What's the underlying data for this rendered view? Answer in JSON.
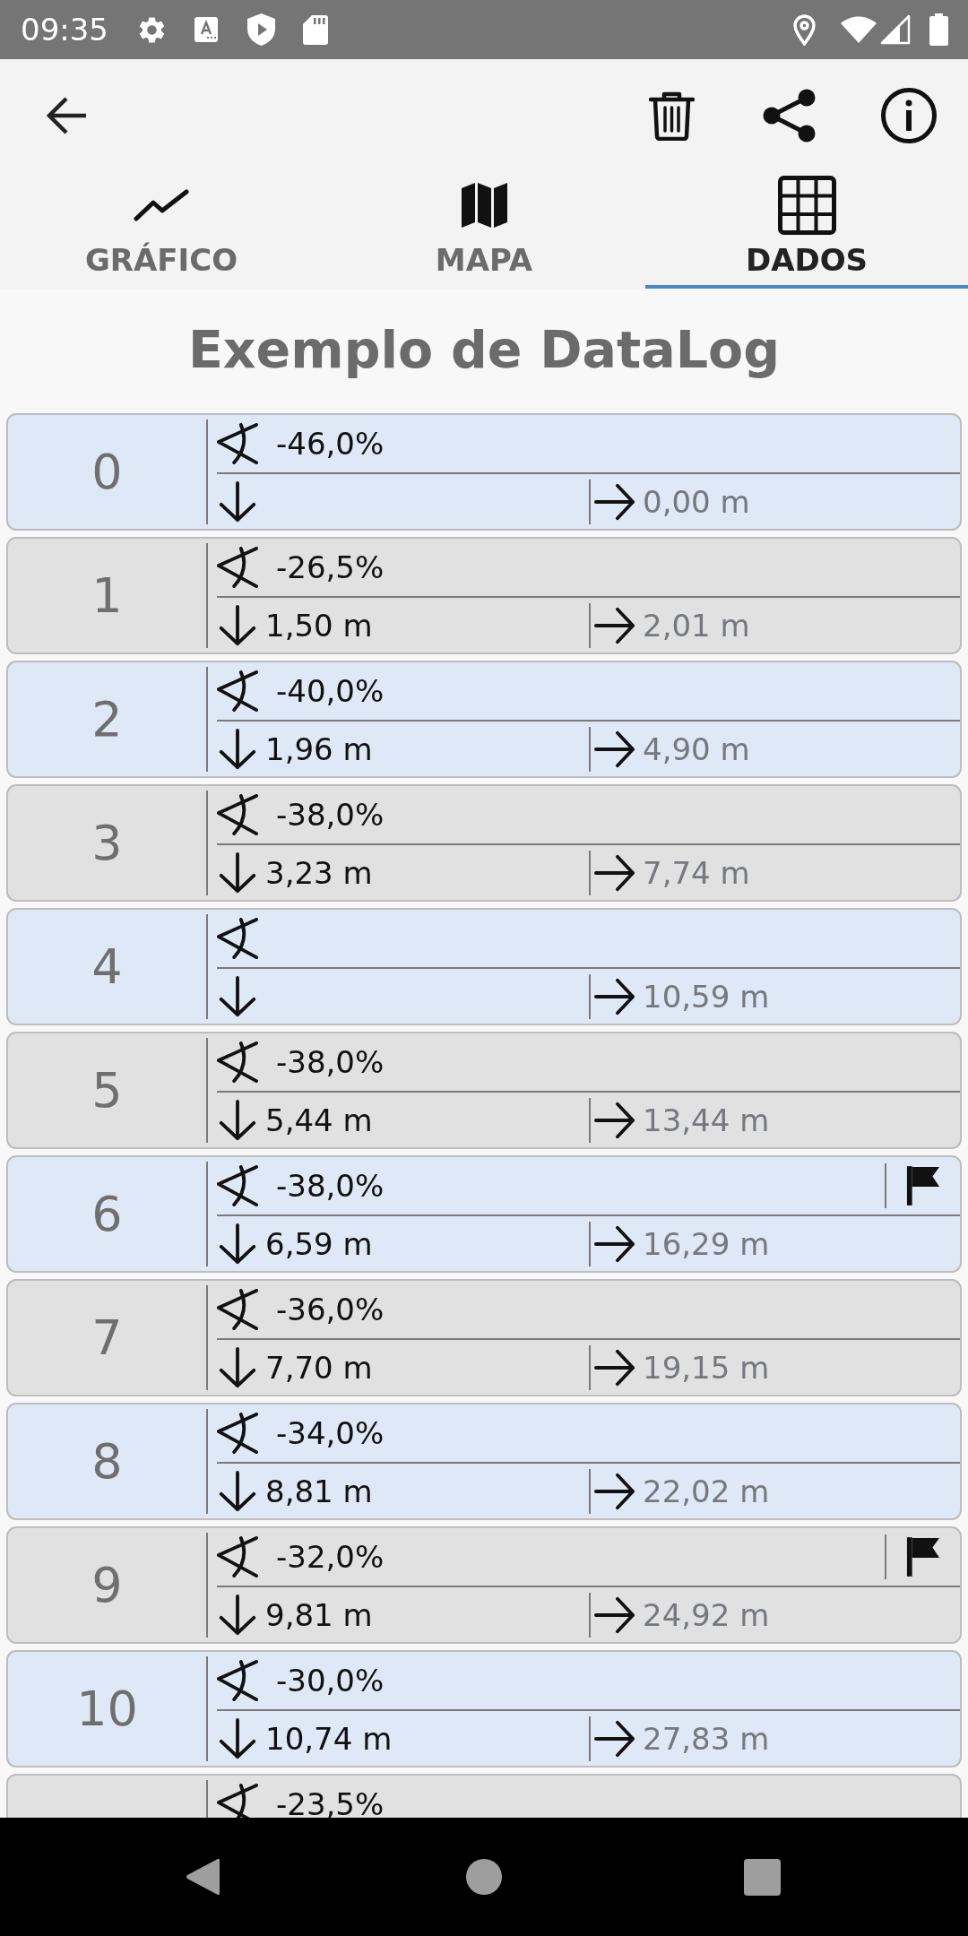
{
  "status_bar": {
    "time": "09:35"
  },
  "tabs": [
    {
      "label": "GRÁFICO",
      "kind": "chart",
      "selected": false
    },
    {
      "label": "MAPA",
      "kind": "map",
      "selected": false
    },
    {
      "label": "DADOS",
      "kind": "table",
      "selected": true
    }
  ],
  "title": "Exemplo de DataLog",
  "rows": [
    {
      "index": "0",
      "slope": "-46,0%",
      "horizontal": "0,00 m",
      "flagged": false
    },
    {
      "index": "1",
      "slope": "-26,5%",
      "vertical": "1,50 m",
      "horizontal": "2,01 m",
      "flagged": false
    },
    {
      "index": "2",
      "slope": "-40,0%",
      "vertical": "1,96 m",
      "horizontal": "4,90 m",
      "flagged": false
    },
    {
      "index": "3",
      "slope": "-38,0%",
      "vertical": "3,23 m",
      "horizontal": "7,74 m",
      "flagged": false
    },
    {
      "index": "4",
      "horizontal": "10,59 m",
      "flagged": false
    },
    {
      "index": "5",
      "slope": "-38,0%",
      "vertical": "5,44 m",
      "horizontal": "13,44 m",
      "flagged": false
    },
    {
      "index": "6",
      "slope": "-38,0%",
      "vertical": "6,59 m",
      "horizontal": "16,29 m",
      "flagged": true
    },
    {
      "index": "7",
      "slope": "-36,0%",
      "vertical": "7,70 m",
      "horizontal": "19,15 m",
      "flagged": false
    },
    {
      "index": "8",
      "slope": "-34,0%",
      "vertical": "8,81 m",
      "horizontal": "22,02 m",
      "flagged": false
    },
    {
      "index": "9",
      "slope": "-32,0%",
      "vertical": "9,81 m",
      "horizontal": "24,92 m",
      "flagged": true
    },
    {
      "index": "10",
      "slope": "-30,0%",
      "vertical": "10,74 m",
      "horizontal": "27,83 m",
      "flagged": false
    },
    {
      "slope": "-23,5%",
      "flagged": false
    }
  ]
}
